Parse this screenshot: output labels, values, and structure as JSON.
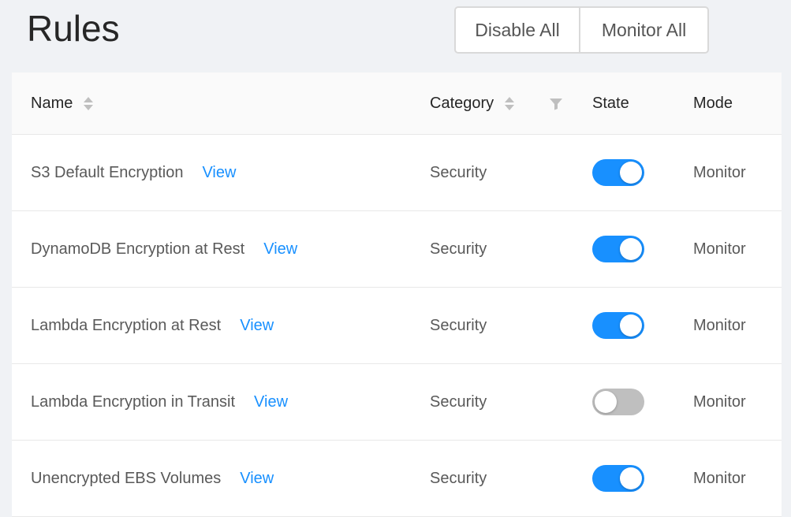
{
  "page": {
    "title": "Rules"
  },
  "toolbar": {
    "disable_all_label": "Disable All",
    "monitor_all_label": "Monitor All"
  },
  "table": {
    "columns": {
      "name": "Name",
      "category": "Category",
      "state": "State",
      "mode": "Mode"
    },
    "rows": [
      {
        "name": "S3 Default Encryption",
        "view": "View",
        "category": "Security",
        "enabled": true,
        "mode": "Monitor"
      },
      {
        "name": "DynamoDB Encryption at Rest",
        "view": "View",
        "category": "Security",
        "enabled": true,
        "mode": "Monitor"
      },
      {
        "name": "Lambda Encryption at Rest",
        "view": "View",
        "category": "Security",
        "enabled": true,
        "mode": "Monitor"
      },
      {
        "name": "Lambda Encryption in Transit",
        "view": "View",
        "category": "Security",
        "enabled": false,
        "mode": "Monitor"
      },
      {
        "name": "Unencrypted EBS Volumes",
        "view": "View",
        "category": "Security",
        "enabled": true,
        "mode": "Monitor"
      }
    ]
  },
  "colors": {
    "accent": "#1890ff",
    "toggle_on": "#1890ff",
    "toggle_off": "#bfbfbf",
    "background": "#f0f2f5"
  },
  "icons": {
    "sort": "sort-caret-icon",
    "filter": "filter-icon"
  }
}
